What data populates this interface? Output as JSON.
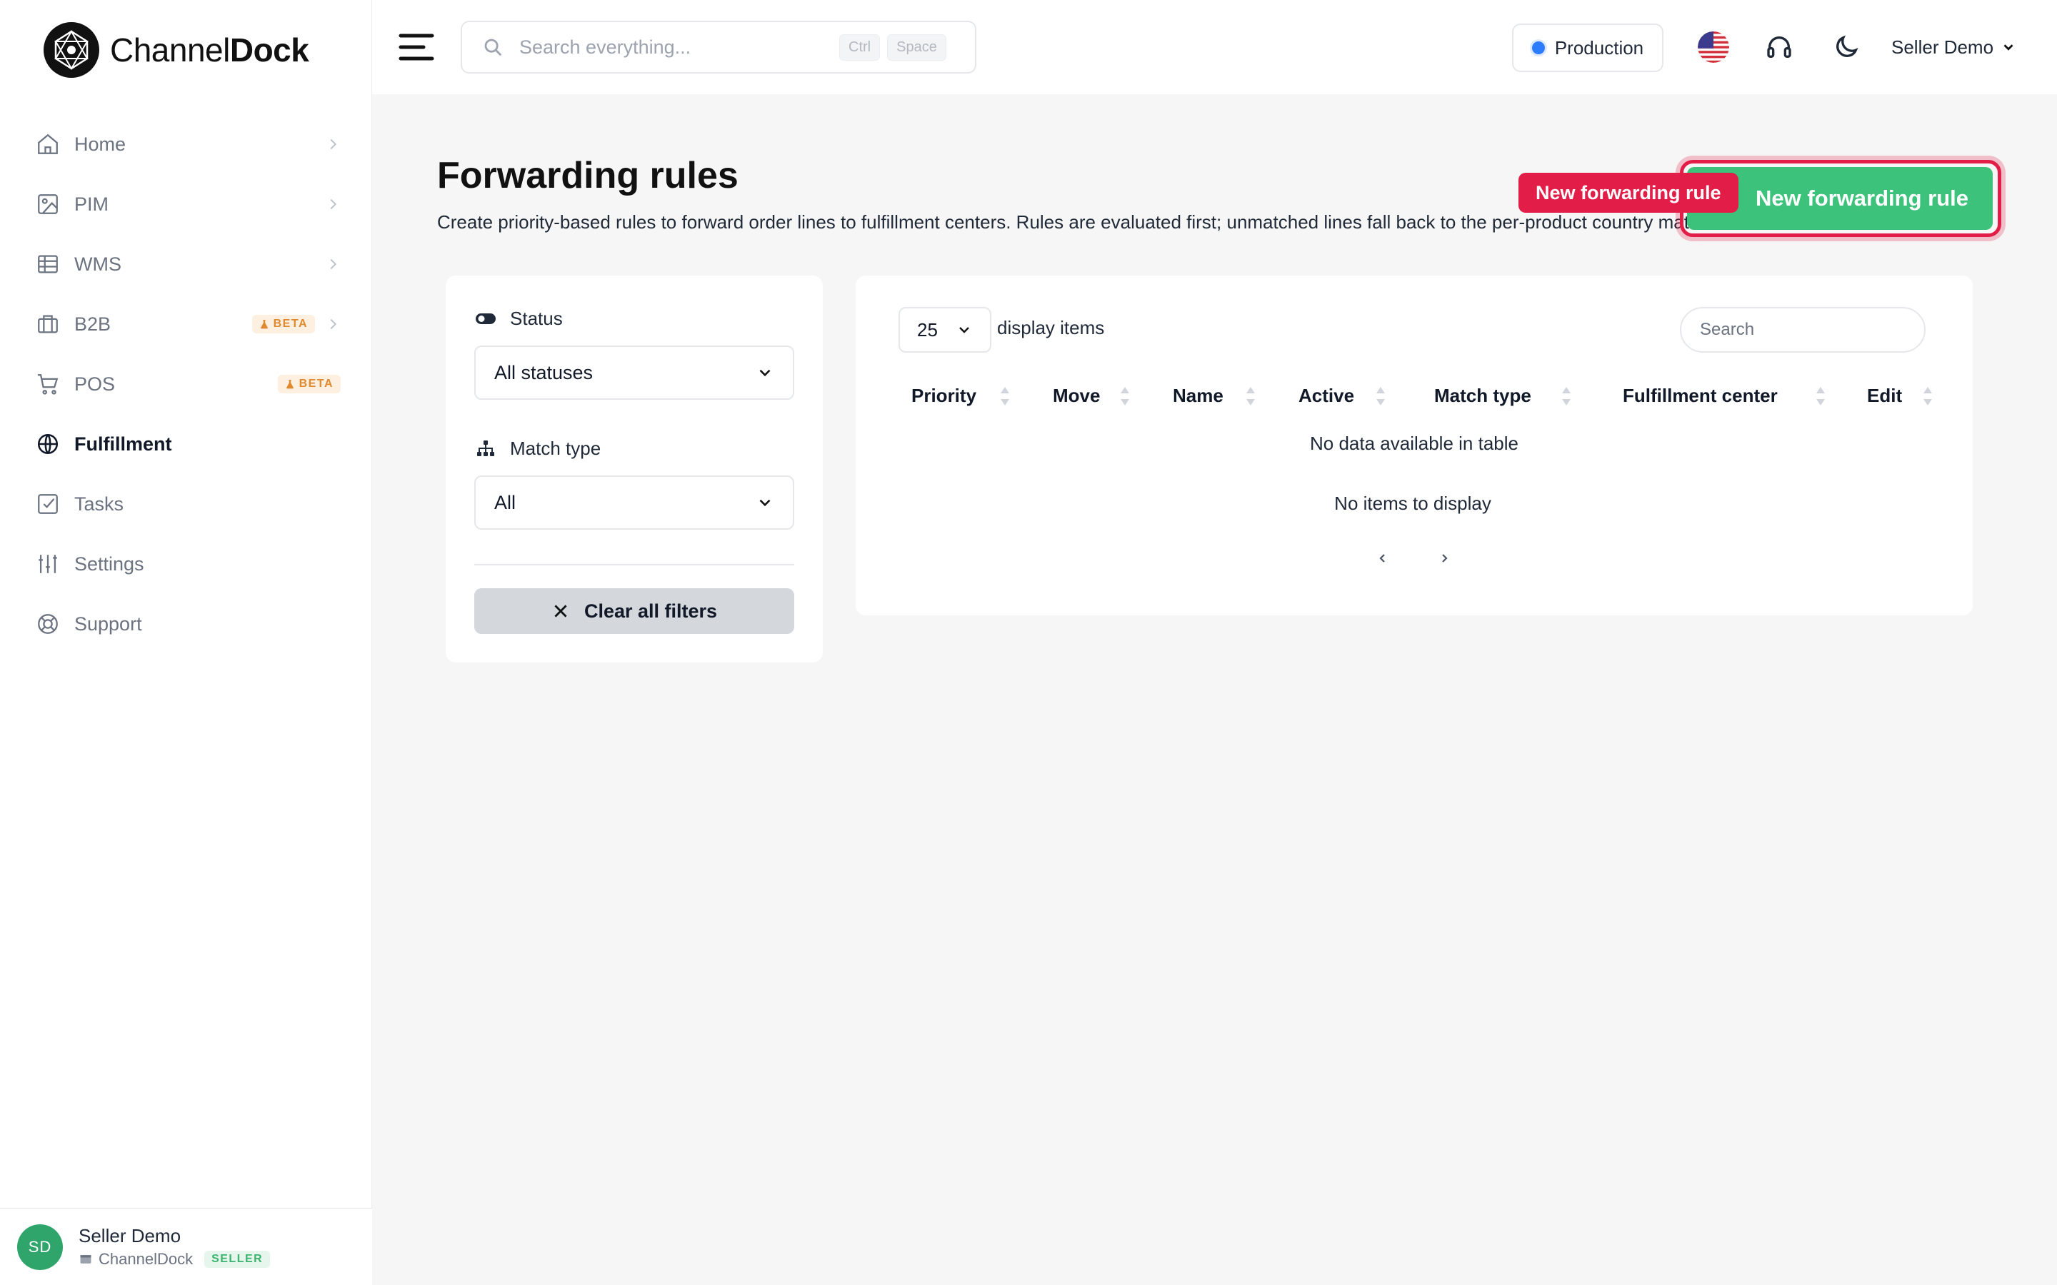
{
  "brand": {
    "name_light": "Channel",
    "name_bold": "Dock"
  },
  "sidebar": {
    "items": [
      {
        "label": "Home",
        "icon": "home-icon",
        "chevron": true
      },
      {
        "label": "PIM",
        "icon": "image-icon",
        "chevron": true
      },
      {
        "label": "WMS",
        "icon": "table-icon",
        "chevron": true
      },
      {
        "label": "B2B",
        "icon": "briefcase-icon",
        "chevron": true,
        "badge": "BETA"
      },
      {
        "label": "POS",
        "icon": "cart-icon",
        "chevron": false,
        "badge": "BETA"
      },
      {
        "label": "Fulfillment",
        "icon": "globe-icon",
        "chevron": false,
        "active": true
      },
      {
        "label": "Tasks",
        "icon": "checkbox-icon",
        "chevron": false
      },
      {
        "label": "Settings",
        "icon": "sliders-icon",
        "chevron": false
      },
      {
        "label": "Support",
        "icon": "lifebuoy-icon",
        "chevron": false
      }
    ],
    "user": {
      "initials": "SD",
      "name": "Seller Demo",
      "org": "ChannelDock",
      "role": "SELLER"
    }
  },
  "header": {
    "search_placeholder": "Search everything...",
    "shortcut_1": "Ctrl",
    "shortcut_2": "Space",
    "environment": "Production",
    "user_menu": "Seller Demo"
  },
  "page": {
    "title": "Forwarding rules",
    "description": "Create priority-based rules to forward order lines to fulfillment centers. Rules are evaluated first; unmatched lines fall back to the per-product country matrix.",
    "new_button": "New forwarding rule",
    "highlight_tag": "New forwarding rule"
  },
  "filters": {
    "status_label": "Status",
    "status_value": "All statuses",
    "match_label": "Match type",
    "match_value": "All",
    "clear_label": "Clear all filters"
  },
  "table": {
    "page_size": "25",
    "page_size_label": "display items",
    "search_placeholder": "Search",
    "columns": [
      "Priority",
      "Move",
      "Name",
      "Active",
      "Match type",
      "Fulfillment center",
      "Edit"
    ],
    "empty_message": "No data available in table",
    "no_items": "No items to display"
  },
  "colors": {
    "accent_green": "#3cc27a",
    "highlight_red": "#e11d48",
    "beta_orange": "#e0892f",
    "env_blue": "#2b7cff"
  }
}
